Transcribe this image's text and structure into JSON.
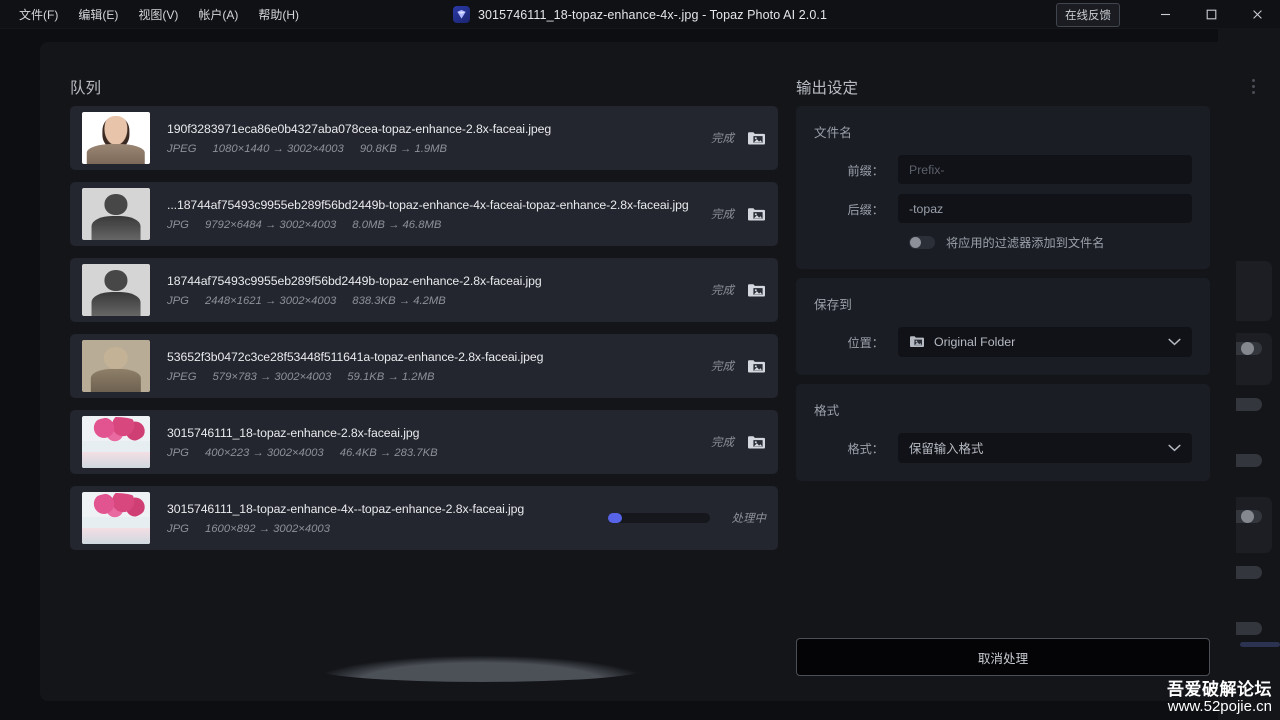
{
  "titlebar": {
    "menus": [
      "文件(F)",
      "编辑(E)",
      "视图(V)",
      "帐户(A)",
      "帮助(H)"
    ],
    "title": "3015746111_18-topaz-enhance-4x-.jpg - Topaz Photo AI 2.0.1",
    "feedback_label": "在线反馈",
    "logo_icon": "topaz-gem-icon",
    "minimize_icon": "minimize-icon",
    "maximize_icon": "maximize-icon",
    "close_icon": "close-icon"
  },
  "queue": {
    "title": "队列",
    "items": [
      {
        "name": "190f3283971eca86e0b4327aba078cea-topaz-enhance-2.8x-faceai.jpeg",
        "format": "JPEG",
        "dimensions": "1080×1440 → 3002×4003",
        "size": "90.8KB → 1.9MB",
        "status": "完成",
        "thumb": "th-portrait-a",
        "progress": null
      },
      {
        "name": "...18744af75493c9955eb289f56bd2449b-topaz-enhance-4x-faceai-topaz-enhance-2.8x-faceai.jpg",
        "format": "JPG",
        "dimensions": "9792×6484 → 3002×4003",
        "size": "8.0MB → 46.8MB",
        "status": "完成",
        "thumb": "th-bw",
        "progress": null
      },
      {
        "name": "18744af75493c9955eb289f56bd2449b-topaz-enhance-2.8x-faceai.jpg",
        "format": "JPG",
        "dimensions": "2448×1621 → 3002×4003",
        "size": "838.3KB → 4.2MB",
        "status": "完成",
        "thumb": "th-bw",
        "progress": null
      },
      {
        "name": "53652f3b0472c3ce28f53448f511641a-topaz-enhance-2.8x-faceai.jpeg",
        "format": "JPEG",
        "dimensions": "579×783 → 3002×4003",
        "size": "59.1KB → 1.2MB",
        "status": "完成",
        "thumb": "th-sepia",
        "progress": null
      },
      {
        "name": "3015746111_18-topaz-enhance-2.8x-faceai.jpg",
        "format": "JPG",
        "dimensions": "400×223 → 3002×4003",
        "size": "46.4KB → 283.7KB",
        "status": "完成",
        "thumb": "th-tree",
        "progress": null
      },
      {
        "name": "3015746111_18-topaz-enhance-4x--topaz-enhance-2.8x-faceai.jpg",
        "format": "JPG",
        "dimensions": "1600×892 → 3002×4003",
        "size": "",
        "status": "处理中",
        "thumb": "th-tree",
        "progress": 14
      }
    ],
    "folder_icon": "image-folder-icon"
  },
  "output": {
    "title": "输出设定",
    "filename_card": {
      "heading": "文件名",
      "prefix_label": "前缀：",
      "prefix_value": "",
      "prefix_placeholder": "Prefix-",
      "suffix_label": "后缀：",
      "suffix_value": "-topaz",
      "toggle_label": "将应用的过滤器添加到文件名",
      "toggle_on": false
    },
    "saveto_card": {
      "heading": "保存到",
      "location_label": "位置：",
      "location_value": "Original Folder",
      "location_icon": "image-folder-icon",
      "chevron_icon": "chevron-down-icon"
    },
    "format_card": {
      "heading": "格式",
      "format_label": "格式：",
      "format_value": "保留输入格式",
      "chevron_icon": "chevron-down-icon"
    },
    "cancel_button": "取消处理"
  },
  "watermark": {
    "line1": "吾爱破解论坛",
    "line2": "www.52pojie.cn"
  },
  "colors": {
    "accent": "#5864e8",
    "modal_bg": "#131519",
    "row_bg": "#23262e",
    "card_bg": "#1a1d24",
    "input_bg": "#101218"
  }
}
